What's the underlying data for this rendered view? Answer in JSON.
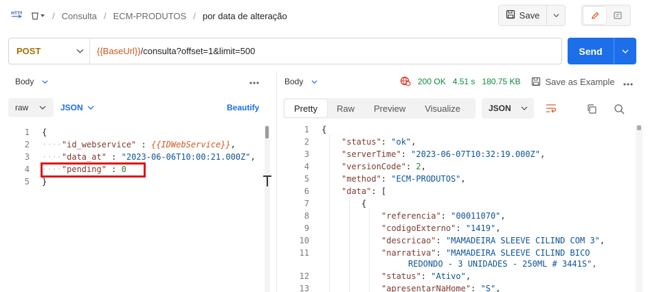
{
  "breadcrumb": {
    "items": [
      "Consulta",
      "ECM-PRODUTOS"
    ],
    "current": "por data de alteração",
    "separator": "/"
  },
  "toolbar": {
    "save_label": "Save"
  },
  "request": {
    "method": "POST",
    "url_var": "{{BaseUrl}}",
    "url_path": "/consulta?offset=1&limit=500",
    "send_label": "Send"
  },
  "left_pane": {
    "section": "Body",
    "mode": "raw",
    "format": "JSON",
    "beautify": "Beautify",
    "lines": [
      {
        "n": "1",
        "t": "{"
      },
      {
        "n": "2",
        "k": "\"id_webservice\"",
        "sep": " : ",
        "v": "{{IDWebService}}",
        "end": ","
      },
      {
        "n": "3",
        "k": "\"data_at\"",
        "sep": " : ",
        "v": "\"2023-06-06T10:00:21.000Z\"",
        "end": ","
      },
      {
        "n": "4",
        "k": "\"pending\"",
        "sep": " : ",
        "v": "0",
        "end": ""
      },
      {
        "n": "5",
        "t": "}"
      }
    ]
  },
  "right_pane": {
    "section": "Body",
    "status_code": "200 OK",
    "time": "4.51 s",
    "size": "180.75 KB",
    "save_example": "Save as Example",
    "tabs": [
      "Pretty",
      "Raw",
      "Preview",
      "Visualize"
    ],
    "active_tab": "Pretty",
    "format": "JSON",
    "lines": [
      {
        "n": "1",
        "parts": [
          "{"
        ]
      },
      {
        "n": "2",
        "k": "\"status\"",
        "v": "\"ok\"",
        "e": ","
      },
      {
        "n": "3",
        "k": "\"serverTime\"",
        "v": "\"2023-06-07T10:32:19.000Z\"",
        "e": ","
      },
      {
        "n": "4",
        "k": "\"versionCode\"",
        "v": "2",
        "e": ","
      },
      {
        "n": "5",
        "k": "\"method\"",
        "v": "\"ECM-PRODUTOS\"",
        "e": ","
      },
      {
        "n": "6",
        "k": "\"data\"",
        "v": "[",
        "e": ""
      },
      {
        "n": "7",
        "parts": [
          "{"
        ]
      },
      {
        "n": "8",
        "k": "\"referencia\"",
        "v": "\"00011070\"",
        "e": ","
      },
      {
        "n": "9",
        "k": "\"codigoExterno\"",
        "v": "\"1419\"",
        "e": ","
      },
      {
        "n": "10",
        "k": "\"descricao\"",
        "v": "\"MAMADEIRA SLEEVE CILIND COM 3\"",
        "e": ","
      },
      {
        "n": "11",
        "k": "\"narrativa\"",
        "v": "\"MAMADEIRA SLEEVE CILIND BICO",
        "e": ""
      },
      {
        "n": "",
        "cont": "REDONDO - 3 UNIDADES - 250ML # 3441S\","
      },
      {
        "n": "12",
        "k": "\"status\"",
        "v": "\"Ativo\"",
        "e": ","
      },
      {
        "n": "13",
        "k": "\"apresentarNaHome\"",
        "v": "\"S\"",
        "e": ","
      }
    ]
  }
}
